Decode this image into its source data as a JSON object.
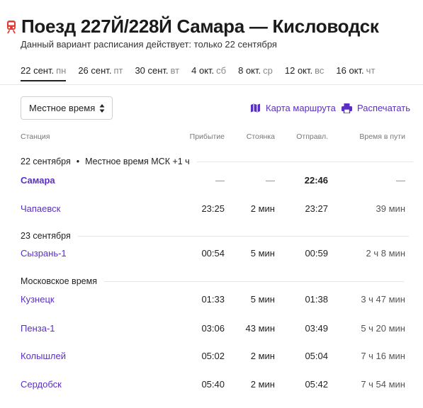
{
  "header": {
    "title": "Поезд 227Й/228Й Самара — Кисловодск",
    "subtitle": "Данный вариант расписания действует: только 22 сентября"
  },
  "dates": [
    {
      "date": "22 сент.",
      "weekday": "пн",
      "active": true
    },
    {
      "date": "26 сент.",
      "weekday": "пт"
    },
    {
      "date": "30 сент.",
      "weekday": "вт"
    },
    {
      "date": "4 окт.",
      "weekday": "сб"
    },
    {
      "date": "8 окт.",
      "weekday": "ср"
    },
    {
      "date": "12 окт.",
      "weekday": "вс"
    },
    {
      "date": "16 окт.",
      "weekday": "чт"
    }
  ],
  "controls": {
    "time_select": "Местное время",
    "route_map": "Карта маршрута",
    "print": "Распечатать"
  },
  "columns": {
    "station": "Станция",
    "arrival": "Прибытие",
    "stop": "Стоянка",
    "departure": "Отправл.",
    "travel": "Время в пути"
  },
  "sections": {
    "s1_date": "22 сентября",
    "s1_bullet": "•",
    "s1_tz": "Местное время МСК +1 ч",
    "s2_date": "23 сентября",
    "s3_tz": "Московское время"
  },
  "rows": [
    {
      "station": "Самара",
      "arrival": "—",
      "stop": "—",
      "departure": "22:46",
      "travel": "—"
    },
    {
      "station": "Чапаевск",
      "arrival": "23:25",
      "stop": "2 мин",
      "departure": "23:27",
      "travel": "39 мин"
    },
    {
      "station": "Сызрань-1",
      "arrival": "00:54",
      "stop": "5 мин",
      "departure": "00:59",
      "travel": "2 ч 8 мин"
    },
    {
      "station": "Кузнецк",
      "arrival": "01:33",
      "stop": "5 мин",
      "departure": "01:38",
      "travel": "3 ч 47 мин"
    },
    {
      "station": "Пенза-1",
      "arrival": "03:06",
      "stop": "43 мин",
      "departure": "03:49",
      "travel": "5 ч 20 мин"
    },
    {
      "station": "Колышлей",
      "arrival": "05:02",
      "stop": "2 мин",
      "departure": "05:04",
      "travel": "7 ч 16 мин"
    },
    {
      "station": "Сердобск",
      "arrival": "05:40",
      "stop": "2 мин",
      "departure": "05:42",
      "travel": "7 ч 54 мин"
    }
  ],
  "colors": {
    "accent": "#5a2fc2",
    "train_icon": "#e53935"
  }
}
